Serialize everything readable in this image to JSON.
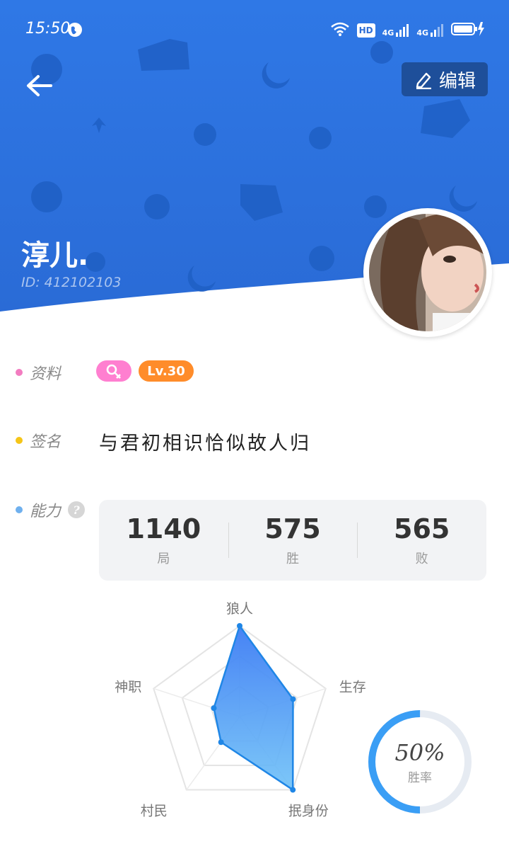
{
  "status_bar": {
    "time": "15:50",
    "hd_label": "HD",
    "sig1": "4G",
    "sig2": "4G"
  },
  "header": {
    "edit_label": "编辑",
    "nickname": "淳儿.",
    "user_id": "ID: 412102103",
    "bg_color": "#2f74e0"
  },
  "profile": {
    "info_label": "资料",
    "level": "Lv.30",
    "signature_label": "签名",
    "signature": "与君初相识恰似故人归",
    "ability_label": "能力",
    "help_glyph": "?"
  },
  "stats": [
    {
      "value": "1140",
      "label": "局"
    },
    {
      "value": "575",
      "label": "胜"
    },
    {
      "value": "565",
      "label": "败"
    }
  ],
  "radar": {
    "axes": [
      "狼人",
      "生存",
      "抿身份",
      "村民",
      "神职"
    ],
    "values": [
      1.0,
      0.62,
      1.0,
      0.35,
      0.3
    ],
    "fill_color": "#3a8ef5"
  },
  "win_rate": {
    "value": "50%",
    "fraction": 0.5,
    "label": "胜率",
    "ring_color": "#3a9ef5",
    "track_color": "#e6ebf2"
  },
  "colors": {
    "dot_info": "#f27cc0",
    "dot_signature": "#f5c518",
    "dot_ability": "#6fb0ee",
    "level_badge": "#ff8c2a",
    "gender_badge": "#ff7fd0"
  }
}
